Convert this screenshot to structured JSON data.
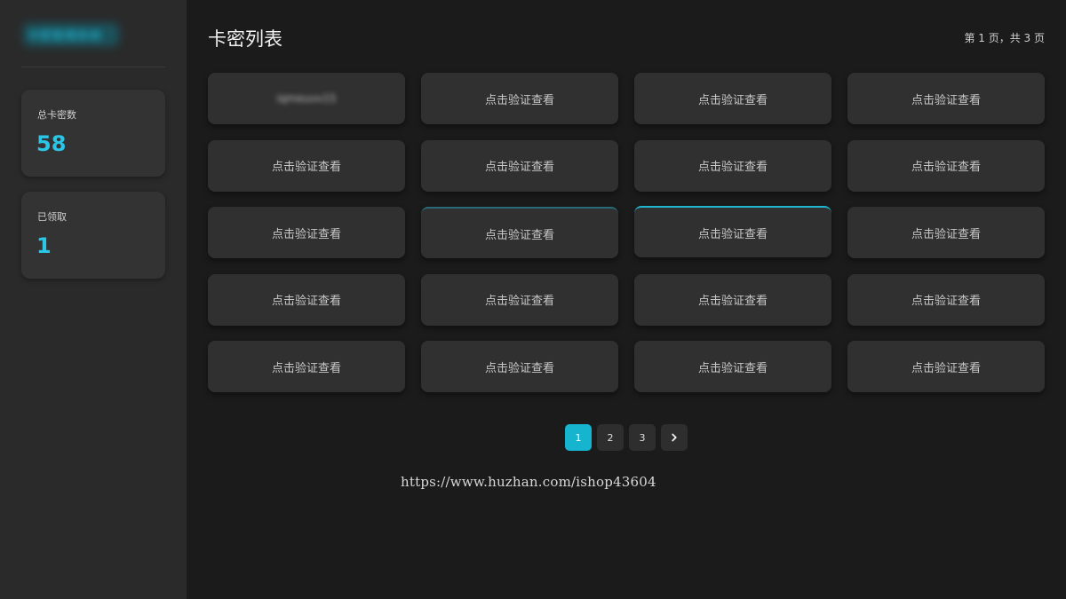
{
  "sidebar": {
    "brand": "卡密管理系统",
    "stats": [
      {
        "label": "总卡密数",
        "value": "58"
      },
      {
        "label": "已领取",
        "value": "1"
      }
    ]
  },
  "header": {
    "title": "卡密列表",
    "page_info": "第 1 页，共 3 页"
  },
  "cards": [
    {
      "label": "iqmeuvv15",
      "state": "revealed"
    },
    {
      "label": "点击验证查看"
    },
    {
      "label": "点击验证查看"
    },
    {
      "label": "点击验证查看"
    },
    {
      "label": "点击验证查看"
    },
    {
      "label": "点击验证查看"
    },
    {
      "label": "点击验证查看"
    },
    {
      "label": "点击验证查看"
    },
    {
      "label": "点击验证查看"
    },
    {
      "label": "点击验证查看"
    },
    {
      "label": "点击验证查看"
    },
    {
      "label": "点击验证查看"
    },
    {
      "label": "点击验证查看"
    },
    {
      "label": "点击验证查看"
    },
    {
      "label": "点击验证查看"
    },
    {
      "label": "点击验证查看"
    },
    {
      "label": "点击验证查看"
    },
    {
      "label": "点击验证查看"
    },
    {
      "label": "点击验证查看"
    },
    {
      "label": "点击验证查看"
    }
  ],
  "pagination": {
    "pages": [
      "1",
      "2",
      "3"
    ],
    "current": "1",
    "next_icon": "chevron-right-icon"
  },
  "watermark": "https://www.huzhan.com/ishop43604",
  "colors": {
    "accent": "#16b4cf",
    "stat_value": "#2bc5e6",
    "background": "#1b1b1b",
    "sidebar": "#2a2a2a",
    "card": "#303030"
  }
}
